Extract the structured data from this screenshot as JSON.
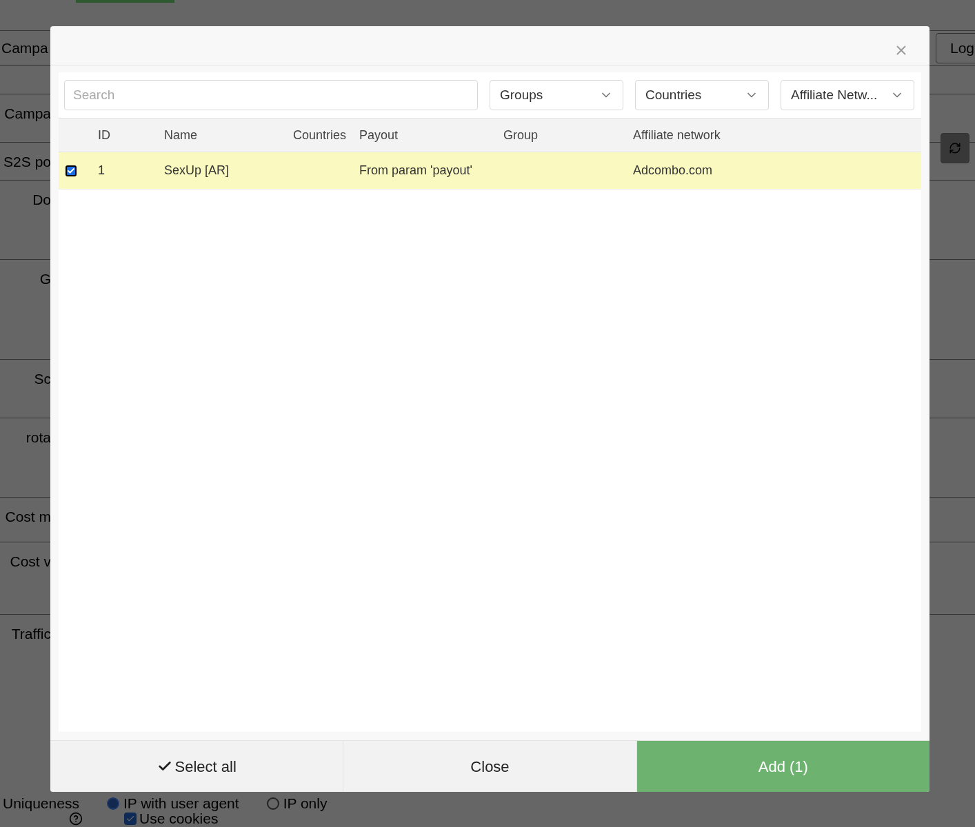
{
  "background": {
    "tab_bar": {
      "tabs": [
        {
          "selected": true
        }
      ]
    },
    "header_field": "Campa",
    "login_button": "Log",
    "form_labels": [
      "Campa",
      "S2S po",
      "Do",
      "G",
      "Sc",
      "rota",
      "Cost m",
      "Cost v",
      "Traffic"
    ],
    "uniqueness": {
      "label": "Uniqueness",
      "options": [
        {
          "label": "IP with user agent",
          "selected": true
        },
        {
          "label": "IP only",
          "selected": false
        }
      ],
      "use_cookies": {
        "label": "Use cookies",
        "checked": true
      }
    }
  },
  "modal": {
    "search": {
      "placeholder": "Search"
    },
    "filters": [
      "Groups",
      "Countries",
      "Affiliate Netw..."
    ],
    "table": {
      "columns": [
        "ID",
        "Name",
        "Countries",
        "Payout",
        "Group",
        "Affiliate network"
      ],
      "rows": [
        {
          "checked": true,
          "selected": true,
          "id": "1",
          "name": "SexUp [AR]",
          "payout": "From param 'payout'",
          "affiliate_network": "Adcombo.com"
        }
      ]
    },
    "buttons": [
      {
        "kind": "select_all",
        "label": "Select all"
      },
      {
        "kind": "close",
        "label": "Close"
      },
      {
        "kind": "primary",
        "label": "Add (1)"
      }
    ]
  }
}
